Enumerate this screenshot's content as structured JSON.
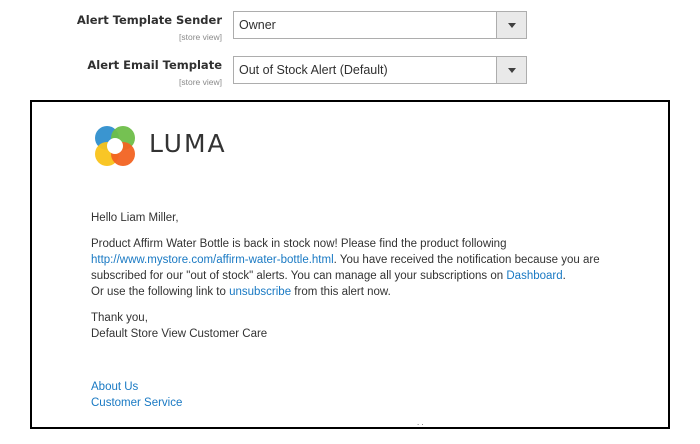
{
  "fields": [
    {
      "label": "Alert Template Sender",
      "scope": "[store view]",
      "value": "Owner"
    },
    {
      "label": "Alert Email Template",
      "scope": "[store view]",
      "value": "Out of Stock Alert (Default)"
    }
  ],
  "preview": {
    "logo_text": "LUMA",
    "greeting": "Hello Liam Miller,",
    "para1": {
      "t1": "Product Affirm Water Bottle is back in stock now! Please find the product following",
      "product_link": "http://www.mystore.com/affirm-water-bottle.html",
      "t2": ". You have received the notification because you are subscribed for our \"out of stock\" alerts. You can manage all your subscriptions on ",
      "dashboard_link": "Dashboard",
      "t3": ".",
      "t4": "Or use the following link to ",
      "unsubscribe_link": "unsubscribe",
      "t5": " from this alert now."
    },
    "thanks": "Thank you,",
    "signature": "Default Store View Customer Care",
    "footer": {
      "about": "About Us",
      "service": "Customer Service"
    },
    "dots": ". ."
  },
  "colors": {
    "link": "#1979c3",
    "logo_orange": "#f26322",
    "logo_yellow": "#f9c31a",
    "logo_green": "#6ebe49",
    "logo_blue": "#2f8fce"
  }
}
